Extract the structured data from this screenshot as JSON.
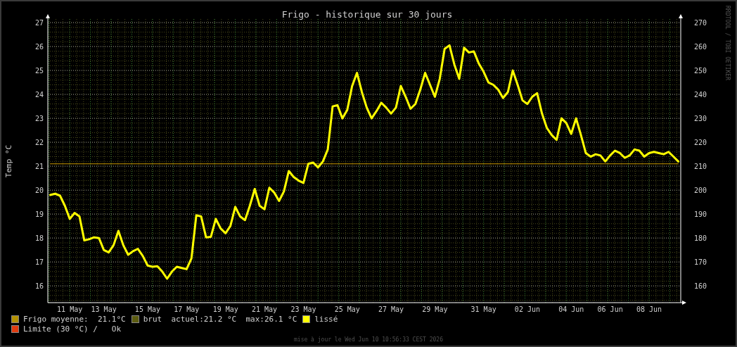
{
  "graph": {
    "side_label": "RRDTOOL / TOBI OETIKER",
    "right_yticks": [
      "270",
      "260",
      "250",
      "240",
      "230",
      "220",
      "210",
      "200",
      "190",
      "180",
      "170",
      "160"
    ],
    "chart_data": {
      "type": "line",
      "title": "Frigo - historique sur 30 jours",
      "ylabel": "Temp °C",
      "categories": [
        null,
        null,
        null,
        null,
        "11 May",
        null,
        null,
        null,
        null,
        null,
        null,
        "13 May",
        null,
        null,
        null,
        null,
        null,
        null,
        null,
        null,
        "15 May",
        null,
        null,
        null,
        null,
        null,
        null,
        null,
        "17 May",
        null,
        null,
        null,
        null,
        null,
        null,
        null,
        "19 May",
        null,
        null,
        null,
        null,
        null,
        null,
        null,
        "21 May",
        null,
        null,
        null,
        null,
        null,
        null,
        null,
        "23 May",
        null,
        null,
        null,
        null,
        null,
        null,
        null,
        null,
        "25 May",
        null,
        null,
        null,
        null,
        null,
        null,
        null,
        null,
        "27 May",
        null,
        null,
        null,
        null,
        null,
        null,
        null,
        null,
        "29 May",
        null,
        null,
        null,
        null,
        null,
        null,
        null,
        null,
        null,
        "31 May",
        null,
        null,
        null,
        null,
        null,
        null,
        null,
        null,
        "02 Jun",
        null,
        null,
        null,
        null,
        null,
        null,
        null,
        null,
        "04 Jun",
        null,
        null,
        null,
        null,
        null,
        null,
        null,
        "06 Jun",
        null,
        null,
        null,
        null,
        null,
        null,
        null,
        "08 Jun",
        null,
        null,
        null,
        null,
        null,
        null
      ],
      "series": [
        {
          "name": "lissé",
          "color": "#ffff00",
          "values": [
            19.8,
            19.85,
            19.77,
            19.35,
            18.8,
            19.05,
            18.9,
            17.9,
            17.95,
            18.03,
            18.0,
            17.5,
            17.4,
            17.7,
            18.3,
            17.7,
            17.3,
            17.45,
            17.55,
            17.25,
            16.85,
            16.8,
            16.82,
            16.6,
            16.3,
            16.6,
            16.8,
            16.75,
            16.7,
            17.15,
            18.95,
            18.9,
            18.03,
            18.05,
            18.8,
            18.4,
            18.2,
            18.5,
            19.3,
            18.9,
            18.75,
            19.35,
            20.05,
            19.35,
            19.2,
            20.1,
            19.9,
            19.55,
            19.95,
            20.8,
            20.55,
            20.4,
            20.3,
            21.1,
            21.15,
            20.95,
            21.2,
            21.7,
            23.5,
            23.55,
            23.0,
            23.35,
            24.35,
            24.9,
            24.1,
            23.45,
            23.0,
            23.3,
            23.65,
            23.45,
            23.2,
            23.45,
            24.35,
            23.9,
            23.4,
            23.6,
            24.2,
            24.9,
            24.4,
            23.9,
            24.65,
            25.9,
            26.05,
            25.25,
            24.65,
            25.95,
            25.75,
            25.8,
            25.3,
            24.95,
            24.5,
            24.4,
            24.2,
            23.85,
            24.1,
            25.0,
            24.4,
            23.75,
            23.6,
            23.9,
            24.05,
            23.2,
            22.6,
            22.3,
            22.1,
            23.0,
            22.8,
            22.35,
            23.0,
            22.3,
            21.55,
            21.4,
            21.5,
            21.45,
            21.2,
            21.45,
            21.65,
            21.55,
            21.35,
            21.45,
            21.7,
            21.65,
            21.4,
            21.55,
            21.6,
            21.55,
            21.5,
            21.6,
            21.4,
            21.2
          ]
        },
        {
          "color": "#c89600",
          "values": [
            21.1,
            21.1,
            21.1,
            21.1,
            21.1,
            21.1,
            21.1,
            21.1,
            21.1,
            21.1,
            21.1,
            21.1,
            21.1,
            21.1,
            21.1,
            21.1,
            21.1,
            21.1,
            21.1,
            21.1,
            21.1,
            21.1,
            21.1,
            21.1,
            21.1,
            21.1,
            21.1,
            21.1,
            21.1,
            21.1,
            21.1,
            21.1,
            21.1,
            21.1,
            21.1,
            21.1,
            21.1,
            21.1,
            21.1,
            21.1,
            21.1,
            21.1,
            21.1,
            21.1,
            21.1,
            21.1,
            21.1,
            21.1,
            21.1,
            21.1,
            21.1,
            21.1,
            21.1,
            21.1,
            21.1,
            21.1,
            21.1,
            21.1,
            21.1,
            21.1,
            21.1,
            21.1,
            21.1,
            21.1,
            21.1,
            21.1,
            21.1,
            21.1,
            21.1,
            21.1,
            21.1,
            21.1,
            21.1,
            21.1,
            21.1,
            21.1,
            21.1,
            21.1,
            21.1,
            21.1,
            21.1,
            21.1,
            21.1,
            21.1,
            21.1,
            21.1,
            21.1,
            21.1,
            21.1,
            21.1,
            21.1,
            21.1,
            21.1,
            21.1,
            21.1,
            21.1,
            21.1,
            21.1,
            21.1,
            21.1,
            21.1,
            21.1,
            21.1,
            21.1,
            21.1,
            21.1,
            21.1,
            21.1,
            21.1,
            21.1,
            21.1,
            21.1,
            21.1,
            21.1,
            21.1,
            21.1,
            21.1,
            21.1,
            21.1,
            21.1,
            21.1,
            21.1,
            21.1,
            21.1,
            21.1,
            21.1,
            21.1,
            21.1,
            21.1,
            21.1
          ]
        }
      ],
      "grid": true,
      "ylim": [
        15.3,
        27.15
      ],
      "yticks": [
        16,
        17,
        18,
        19,
        20,
        21,
        22,
        23,
        24,
        25,
        26,
        27
      ]
    }
  },
  "legend": [
    [
      {
        "color": "#b39100",
        "text": "Frigo moyenne:  21.1°C"
      },
      {
        "color": "#5c5c10",
        "text": "brut  actuel:21.2 °C  max:26.1 °C"
      },
      {
        "kind": "series"
      }
    ],
    [
      {
        "color": "#e03c10",
        "text": "Limite (30 °C) /   Ok"
      }
    ]
  ],
  "footer": "mise à jour le Wed Jun 10 10:56:33 CEST 2026"
}
